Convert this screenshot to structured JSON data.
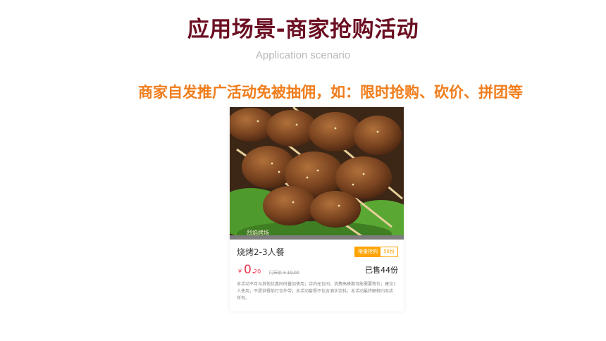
{
  "slide": {
    "title": "应用场景-商家抢购活动",
    "subtitle": "Application scenario",
    "headline": "商家自发推广活动免被抽佣，如：限时抢购、砍价、拼团等"
  },
  "deal_card": {
    "photo_caption": "烈焰烤场",
    "product_name": "烧烤2-3人餐",
    "badge_label": "限量抢购",
    "badge_count": "56份",
    "currency": "¥",
    "price_integer": "0.",
    "price_decimal": "20",
    "original_price": "门市价 ¥ 10.00",
    "sold": "已售44份",
    "terms": "本活动不可与其他优惠同时叠加使用；店内无包间，消费高峰期可能需要等位；建议1人使用，不提供餐前打包外带；本活动套餐不包含酒水饮料；本活动最终解释归本店所有。"
  }
}
